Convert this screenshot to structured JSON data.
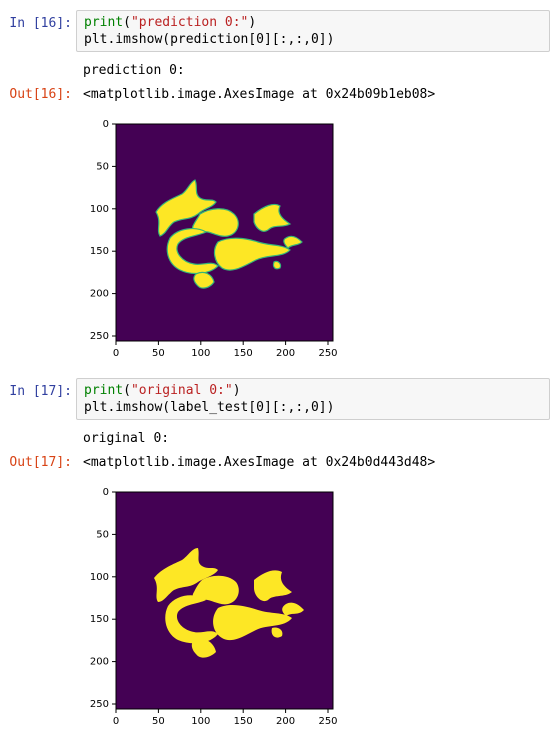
{
  "cells": [
    {
      "in_prompt": "In [16]:",
      "code": [
        {
          "fn": "print",
          "open": "(",
          "str": "\"prediction 0:\"",
          "close": ")"
        },
        {
          "plain": "plt.imshow(prediction[0][:,:,0])"
        }
      ],
      "stdout": "prediction 0:",
      "out_prompt": "Out[16]:",
      "out_repr": "<matplotlib.image.AxesImage at 0x24b09b1eb08>"
    },
    {
      "in_prompt": "In [17]:",
      "code": [
        {
          "fn": "print",
          "open": "(",
          "str": "\"original 0:\"",
          "close": ")"
        },
        {
          "plain": "plt.imshow(label_test[0][:,:,0])"
        }
      ],
      "stdout": "original 0:",
      "out_prompt": "Out[17]:",
      "out_repr": "<matplotlib.image.AxesImage at 0x24b0d443d48>"
    }
  ],
  "colors": {
    "background_class": "#440154",
    "foreground_class": "#fde725",
    "edge": "#35b779"
  },
  "chart_data": [
    {
      "type": "heatmap",
      "xlim": [
        0,
        256
      ],
      "ylim": [
        256,
        0
      ],
      "xticks": [
        0,
        50,
        100,
        150,
        200,
        250
      ],
      "yticks": [
        0,
        50,
        100,
        150,
        200,
        250
      ],
      "xtick_labels": [
        "0",
        "50",
        "100",
        "150",
        "200",
        "250"
      ],
      "ytick_labels": [
        "0",
        "50",
        "100",
        "150",
        "200",
        "250"
      ],
      "colormap": "viridis",
      "content": "binary segmentation mask, yellow blobs on purple background"
    },
    {
      "type": "heatmap",
      "xlim": [
        0,
        256
      ],
      "ylim": [
        256,
        0
      ],
      "xticks": [
        0,
        50,
        100,
        150,
        200,
        250
      ],
      "yticks": [
        0,
        50,
        100,
        150,
        200,
        250
      ],
      "xtick_labels": [
        "0",
        "50",
        "100",
        "150",
        "200",
        "250"
      ],
      "ytick_labels": [
        "0",
        "50",
        "100",
        "150",
        "200",
        "250"
      ],
      "colormap": "viridis",
      "content": "binary segmentation mask, yellow blobs on purple background"
    }
  ]
}
